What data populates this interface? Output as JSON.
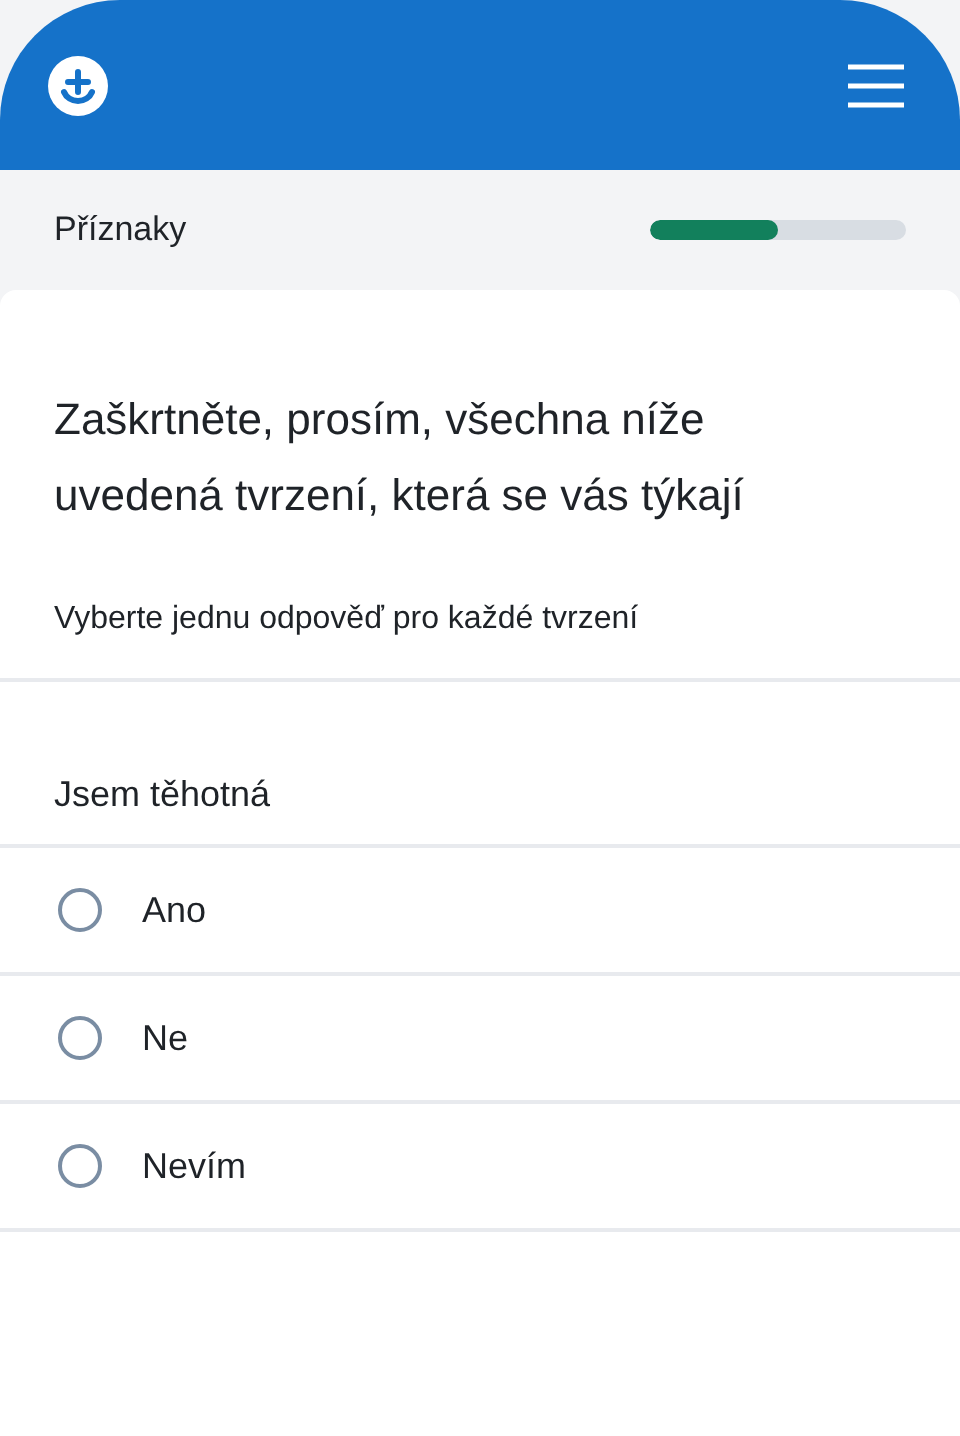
{
  "section": {
    "title": "Příznaky",
    "level": 0.5
  },
  "question": {
    "title": "Zaškrtněte, prosím, všechna níže uvedená tvrzení, která se vás týkají",
    "hint": "Vyberte jednu odpověď pro každé tvrzení"
  },
  "statement": {
    "label": "Jsem těhotná",
    "options": [
      {
        "label": "Ano",
        "selected": false
      },
      {
        "label": "Ne",
        "selected": false
      },
      {
        "label": "Nevím",
        "selected": false
      }
    ]
  }
}
